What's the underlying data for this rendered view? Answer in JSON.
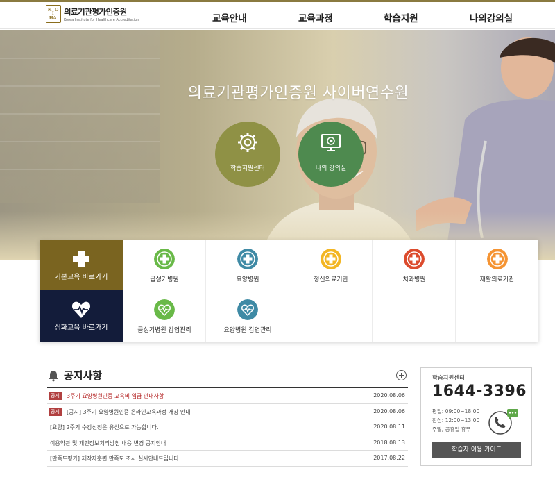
{
  "header": {
    "logo_ko": "의료기관평가인증원",
    "logo_en": "Korea Institute for Healthcare Accreditation",
    "logo_mark": [
      "K",
      "O",
      "I",
      "HA"
    ],
    "nav": [
      "교육안내",
      "교육과정",
      "학습지원",
      "나의강의실"
    ]
  },
  "hero": {
    "title": "의료기관평가인증원 사이버연수원",
    "buttons": [
      {
        "label": "학습지원센터",
        "icon": "gear-icon",
        "color": "#8f9145"
      },
      {
        "label": "나의 강의실",
        "icon": "monitor-play-icon",
        "color": "#4e8a4f"
      }
    ]
  },
  "quick_menu": {
    "basic": {
      "label": "기본교육 바로가기",
      "icon": "plus-icon",
      "color": "#7a6420"
    },
    "advanced": {
      "label": "심화교육 바로가기",
      "icon": "heartbeat-icon",
      "color": "#131c3a"
    },
    "row1": [
      {
        "label": "급성기병원",
        "color": "#69b948"
      },
      {
        "label": "요양병원",
        "color": "#3f8aa5"
      },
      {
        "label": "정신의료기관",
        "color": "#f3b624"
      },
      {
        "label": "치과병원",
        "color": "#dc4b2d"
      },
      {
        "label": "재활의료기관",
        "color": "#f59433"
      }
    ],
    "row2": [
      {
        "label": "급성기병원 감염관리",
        "color": "#69b948"
      },
      {
        "label": "요양병원 감염관리",
        "color": "#3f8aa5"
      }
    ]
  },
  "notice": {
    "title": "공지사항",
    "items": [
      {
        "badge": "공지",
        "title": "3주기 요양병원인증 교육비 입금 안내사항",
        "date": "2020.08.06",
        "highlight": true
      },
      {
        "badge": "공지",
        "title": "[공지] 3주기 요양병원인증 온라인교육과정 개강 안내",
        "date": "2020.08.06",
        "highlight": false
      },
      {
        "badge": "",
        "title": "[요양] 2주기 수강신청은 유선으로 가능합니다.",
        "date": "2020.08.11",
        "highlight": false
      },
      {
        "badge": "",
        "title": "이용약관 및 개인정보처리방침 내용 변경 공지안내",
        "date": "2018.08.13",
        "highlight": false
      },
      {
        "badge": "",
        "title": "[만족도평가] 제작자훈련 만족도 조사 실시안내드립니다.",
        "date": "2017.08.22",
        "highlight": false
      }
    ]
  },
  "support": {
    "title": "학습지원센터",
    "phone": "1644-3396",
    "hours": [
      "평일: 09:00~18:00",
      "점심: 12:00~13:00",
      "주말, 공휴일 휴무"
    ],
    "guide_button": "학습자 이용 가이드"
  }
}
